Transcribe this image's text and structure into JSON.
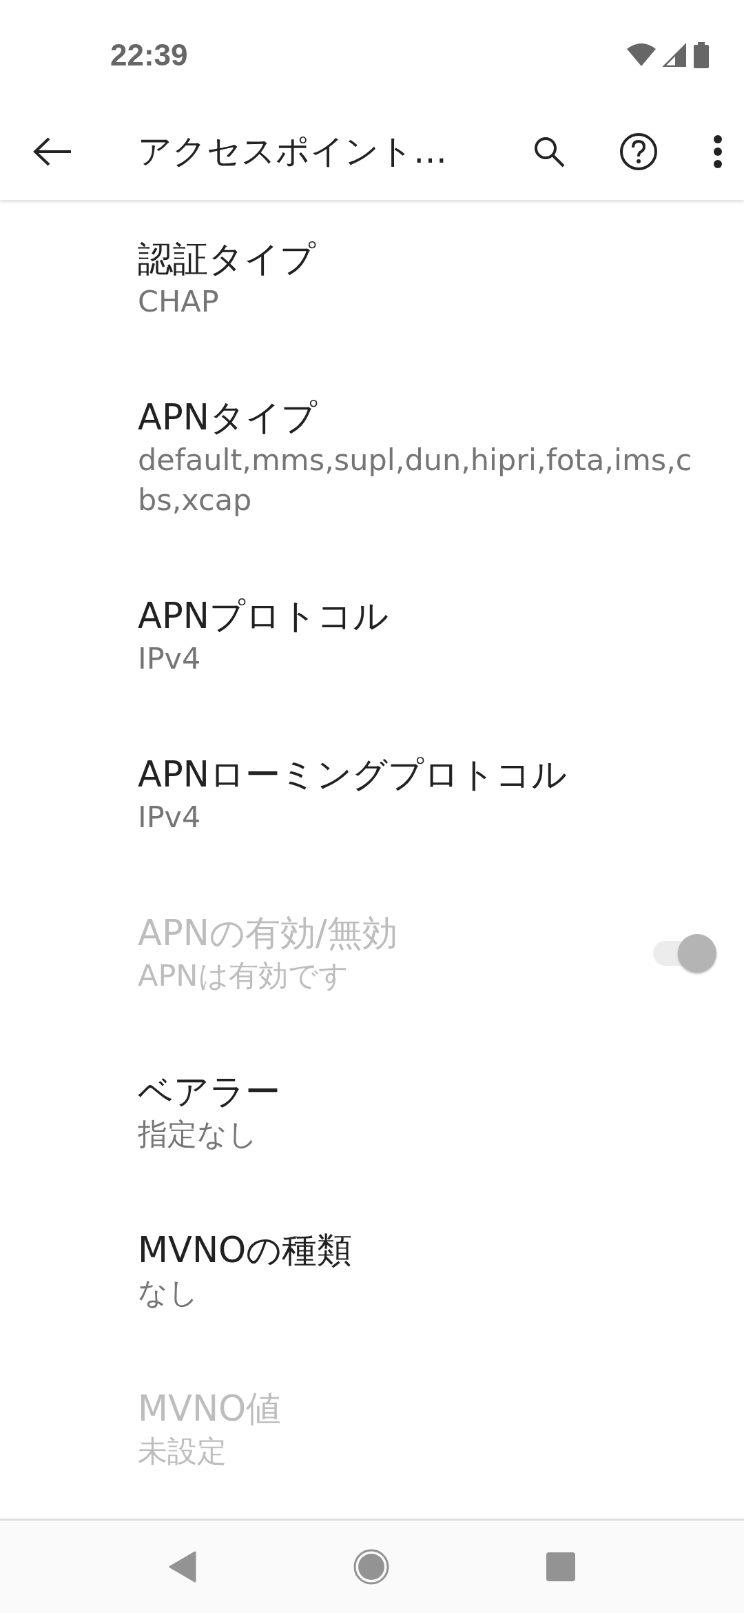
{
  "status_bar": {
    "time": "22:39"
  },
  "toolbar": {
    "title": "アクセスポイント…"
  },
  "preferences": [
    {
      "kind": "text",
      "title": "認証タイプ",
      "summary": "CHAP",
      "disabled": false
    },
    {
      "kind": "text",
      "title": "APNタイプ",
      "summary": "default,mms,supl,dun,hipri,fota,ims,cbs,xcap",
      "disabled": false
    },
    {
      "kind": "text",
      "title": "APNプロトコル",
      "summary": "IPv4",
      "disabled": false
    },
    {
      "kind": "text",
      "title": "APNローミングプロトコル",
      "summary": "IPv4",
      "disabled": false
    },
    {
      "kind": "switch",
      "title": "APNの有効/無効",
      "summary": "APNは有効です",
      "disabled": true,
      "checked": true
    },
    {
      "kind": "text",
      "title": "ベアラー",
      "summary": "指定なし",
      "disabled": false
    },
    {
      "kind": "text",
      "title": "MVNOの種類",
      "summary": "なし",
      "disabled": false
    },
    {
      "kind": "text",
      "title": "MVNO値",
      "summary": "未設定",
      "disabled": true
    }
  ]
}
